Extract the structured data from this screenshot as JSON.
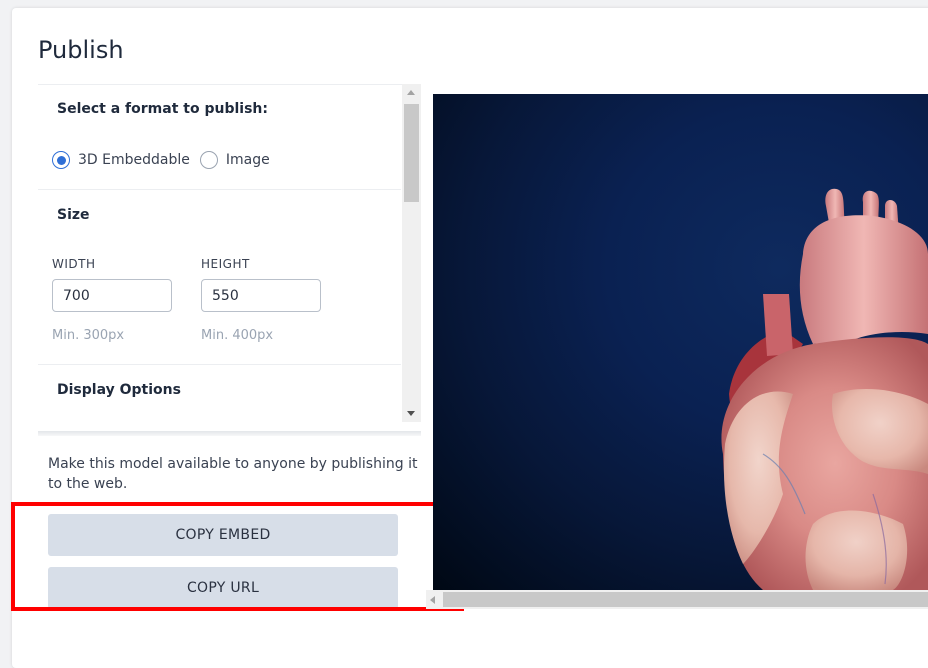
{
  "dialog": {
    "title": "Publish"
  },
  "format": {
    "heading": "Select a format to publish:",
    "options": [
      {
        "label": "3D Embeddable",
        "selected": true
      },
      {
        "label": "Image",
        "selected": false
      }
    ]
  },
  "size": {
    "heading": "Size",
    "width": {
      "label": "WIDTH",
      "value": "700",
      "hint": "Min. 300px"
    },
    "height": {
      "label": "HEIGHT",
      "value": "550",
      "hint": "Min. 400px"
    }
  },
  "display": {
    "heading": "Display Options"
  },
  "publish": {
    "description": "Make this model available to anyone by publishing it to the web.",
    "copy_embed_label": "COPY EMBED",
    "copy_url_label": "COPY URL"
  },
  "colors": {
    "accent": "#2f6fd6",
    "button_bg": "#d7dee8",
    "highlight": "#ff0000",
    "preview_bg": "#0a2152"
  },
  "icons": {
    "radio_on": "radio-selected-icon",
    "radio_off": "radio-unselected-icon",
    "scroll_up": "scroll-up-arrow-icon",
    "scroll_down": "scroll-down-arrow-icon",
    "scroll_left": "scroll-left-arrow-icon",
    "model": "heart-model"
  }
}
